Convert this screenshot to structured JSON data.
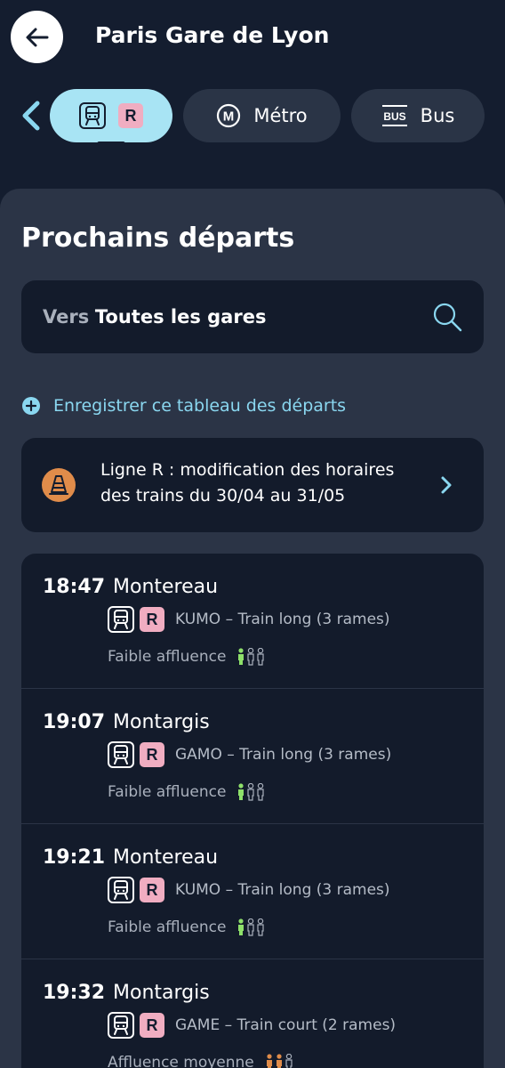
{
  "header": {
    "title": "Paris Gare de Lyon"
  },
  "tabs": [
    {
      "id": "train",
      "badge": "R",
      "selected": true
    },
    {
      "id": "metro",
      "icon_letter": "M",
      "label": "Métro"
    },
    {
      "id": "bus",
      "icon_text": "BUS",
      "label": "Bus"
    }
  ],
  "section": {
    "title": "Prochains départs"
  },
  "search": {
    "prefix": "Vers",
    "value": "Toutes les gares"
  },
  "save_link": {
    "label": "Enregistrer ce tableau des départs"
  },
  "alert": {
    "line1": "Ligne R : modification des horaires",
    "line2": "des trains du 30/04 au 31/05"
  },
  "departures": [
    {
      "time": "18:47",
      "destination": "Montereau",
      "line": "R",
      "info": "KUMO – Train long (3 rames)",
      "crowd": "Faible affluence",
      "crowd_level": 1
    },
    {
      "time": "19:07",
      "destination": "Montargis",
      "line": "R",
      "info": "GAMO – Train long (3 rames)",
      "crowd": "Faible affluence",
      "crowd_level": 1
    },
    {
      "time": "19:21",
      "destination": "Montereau",
      "line": "R",
      "info": "KUMO – Train long (3 rames)",
      "crowd": "Faible affluence",
      "crowd_level": 1
    },
    {
      "time": "19:32",
      "destination": "Montargis",
      "line": "R",
      "info": "GAME – Train court (2 rames)",
      "crowd": "Affluence moyenne",
      "crowd_level": 2
    }
  ],
  "colors": {
    "accent": "#8ad7f0",
    "line_r": "#f0adc1",
    "crowd_low": "#8ee06a",
    "crowd_medium": "#e08c4a",
    "alert": "#e08c4a"
  }
}
